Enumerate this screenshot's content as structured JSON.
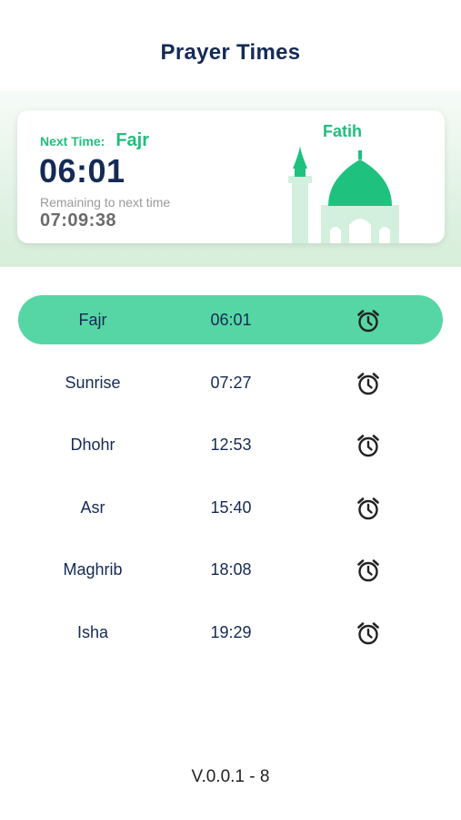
{
  "header": {
    "title": "Prayer Times"
  },
  "next_prayer": {
    "label": "Next Time:",
    "name": "Fajr",
    "time": "06:01",
    "remaining_label": "Remaining to next time",
    "countdown": "07:09:38",
    "location": "Fatih"
  },
  "prayers": [
    {
      "name": "Fajr",
      "time": "06:01",
      "active": true,
      "icon": "alarm-clock-icon"
    },
    {
      "name": "Sunrise",
      "time": "07:27",
      "active": false,
      "icon": "alarm-clock-icon"
    },
    {
      "name": "Dhohr",
      "time": "12:53",
      "active": false,
      "icon": "alarm-clock-icon"
    },
    {
      "name": "Asr",
      "time": "15:40",
      "active": false,
      "icon": "alarm-clock-icon"
    },
    {
      "name": "Maghrib",
      "time": "18:08",
      "active": false,
      "icon": "alarm-clock-icon"
    },
    {
      "name": "Isha",
      "time": "19:29",
      "active": false,
      "icon": "alarm-clock-icon"
    }
  ],
  "footer": {
    "version": "V.0.0.1 - 8"
  },
  "colors": {
    "accent": "#1fbf7c",
    "active_row": "#56d6a4",
    "primary_text": "#152a55",
    "mosque_light": "#d3efde",
    "mosque_dome": "#1ec27e"
  }
}
